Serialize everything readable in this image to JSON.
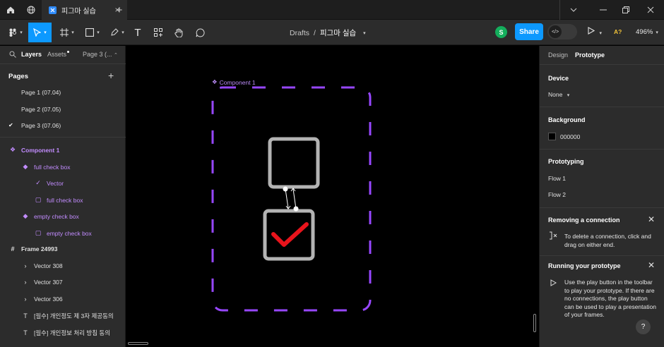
{
  "titlebar": {
    "tab_title": "피그마 실습",
    "window_controls": [
      "chevron-down-icon",
      "minimize-icon",
      "restore-icon",
      "close-icon"
    ]
  },
  "toolbar": {
    "breadcrumb_root": "Drafts",
    "breadcrumb_sep": "/",
    "file_name": "피그마 실습",
    "avatar_letter": "S",
    "share_label": "Share",
    "aa_label": "A?",
    "zoom_label": "496%"
  },
  "left_panel": {
    "tabs": [
      "Layers",
      "Assets",
      "Page 3 (..."
    ],
    "pages_header": "Pages",
    "pages": [
      "Page 1 (07.04)",
      "Page 2 (07.05)",
      "Page 3 (07.06)"
    ],
    "current_page_index": 2,
    "layers": [
      {
        "label": "Component 1",
        "icon": "component-icon",
        "color": "purple"
      },
      {
        "label": "full check box",
        "icon": "instance-icon",
        "color": "purple"
      },
      {
        "label": "Vector",
        "icon": "vector-check-icon",
        "color": "purple"
      },
      {
        "label": "full check box",
        "icon": "rectangle-icon",
        "color": "purple"
      },
      {
        "label": "empty check box",
        "icon": "instance-icon",
        "color": "purple"
      },
      {
        "label": "empty check box",
        "icon": "rectangle-icon",
        "color": "purple"
      },
      {
        "label": "Frame 24993",
        "icon": "frame-icon",
        "color": "white"
      },
      {
        "label": "Vector 308",
        "icon": "chevron-right-icon",
        "color": "white"
      },
      {
        "label": "Vector 307",
        "icon": "chevron-right-icon",
        "color": "white"
      },
      {
        "label": "Vector 306",
        "icon": "chevron-right-icon",
        "color": "white"
      },
      {
        "label": "[필수] 개인정도 제 3자 제공동의",
        "icon": "text-icon",
        "color": "white"
      },
      {
        "label": "[필수] 개인정보 처리 방침 동의",
        "icon": "text-icon",
        "color": "white"
      }
    ]
  },
  "canvas": {
    "component_label": "Component 1",
    "frame_color": "#9747ff",
    "check_color": "#e8141c",
    "box_color": "#b3b3b3"
  },
  "right_panel": {
    "tabs": [
      "Design",
      "Prototype"
    ],
    "device_header": "Device",
    "device_value": "None",
    "background_header": "Background",
    "background_value": "000000",
    "prototyping_header": "Prototyping",
    "flows": [
      "Flow 1",
      "Flow 2"
    ],
    "removing_header": "Removing a connection",
    "removing_text": "To delete a connection, click and drag on either end.",
    "running_header": "Running your prototype",
    "running_text": "Use the play button in the toolbar to play your prototype. If there are no connections, the play button can be used to play a presentation of your frames.",
    "help_label": "?"
  }
}
